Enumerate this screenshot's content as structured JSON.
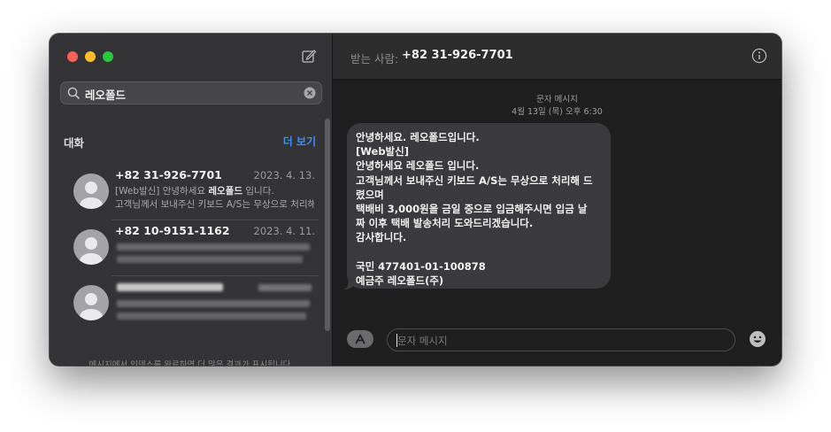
{
  "window": {
    "colors": {
      "close": "#fe5f57",
      "minimize": "#febc2e",
      "zoom": "#28c840",
      "accent": "#3b8cf5",
      "bubble": "#3a3a3c"
    }
  },
  "sidebar": {
    "search": {
      "value": "레오폴드",
      "icon": "search-icon",
      "clear_icon": "clear-icon"
    },
    "compose_icon": "compose-icon",
    "section": {
      "title": "대화",
      "more": "더 보기"
    },
    "conversations": [
      {
        "name": "+82 31-926-7701",
        "date": "2023. 4. 13.",
        "preview_prefix": "[Web발신] 안녕하세요 ",
        "preview_match": "레오폴드",
        "preview_suffix": " 입니다.",
        "preview_line2": "고객님께서 보내주신 키보드 A/S는 무상으로 처리해 드렸으며"
      },
      {
        "name": "+82 10-9151-1162",
        "date": "2023. 4. 11."
      },
      {}
    ],
    "footer": "메시지에서 인덱스를 완료하면 더 많은 결과가 표시됩니다."
  },
  "main": {
    "header": {
      "to_label": "받는 사람:",
      "to_value": "+82 31-926-7701",
      "info_icon": "info-icon"
    },
    "thread": {
      "service": "문자 메시지",
      "timestamp": "4월 13일 (목) 오후 6:30"
    },
    "message": "안녕하세요. 레오폴드입니다.\n[Web발신]\n안녕하세요 레오폴드 입니다.\n고객님께서 보내주신 키보드 A/S는 무상으로 처리해 드\n렸으며\n택배비 3,000원을 금일 중으로 입금해주시면 입금 날\n짜 이후 택배 발송처리 도와드리겠습니다.\n감사합니다.\n\n국민 477401-01-100878\n예금주 레오폴드(주)",
    "composer": {
      "placeholder": "문자 메시지",
      "apps_icon": "app-store-icon",
      "emoji_icon": "emoji-icon"
    }
  }
}
